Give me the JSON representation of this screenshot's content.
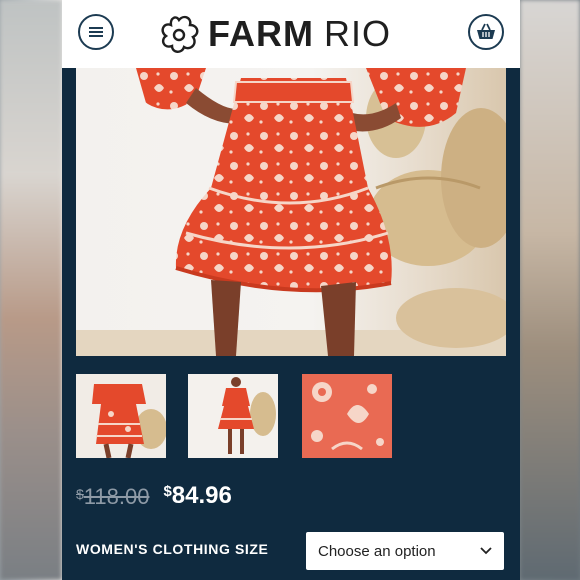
{
  "header": {
    "brand_part1": "FARM",
    "brand_part2": "RIO",
    "menu_icon": "hamburger-menu-icon",
    "cart_icon": "shopping-basket-icon"
  },
  "product": {
    "hero_image": "model in red-orange floral print tiered mini skirt and top",
    "thumbnails": [
      {
        "name": "thumb-front-view"
      },
      {
        "name": "thumb-full-length-view"
      },
      {
        "name": "thumb-print-detail"
      }
    ],
    "price": {
      "currency": "$",
      "original": "118.00",
      "sale": "84.96"
    },
    "size": {
      "label": "WOMEN'S CLOTHING SIZE",
      "selected": "Choose an option"
    }
  },
  "colors": {
    "panel_bg": "#0f2a3f",
    "icon_stroke": "#1c3b52",
    "print_red": "#e4492c"
  }
}
